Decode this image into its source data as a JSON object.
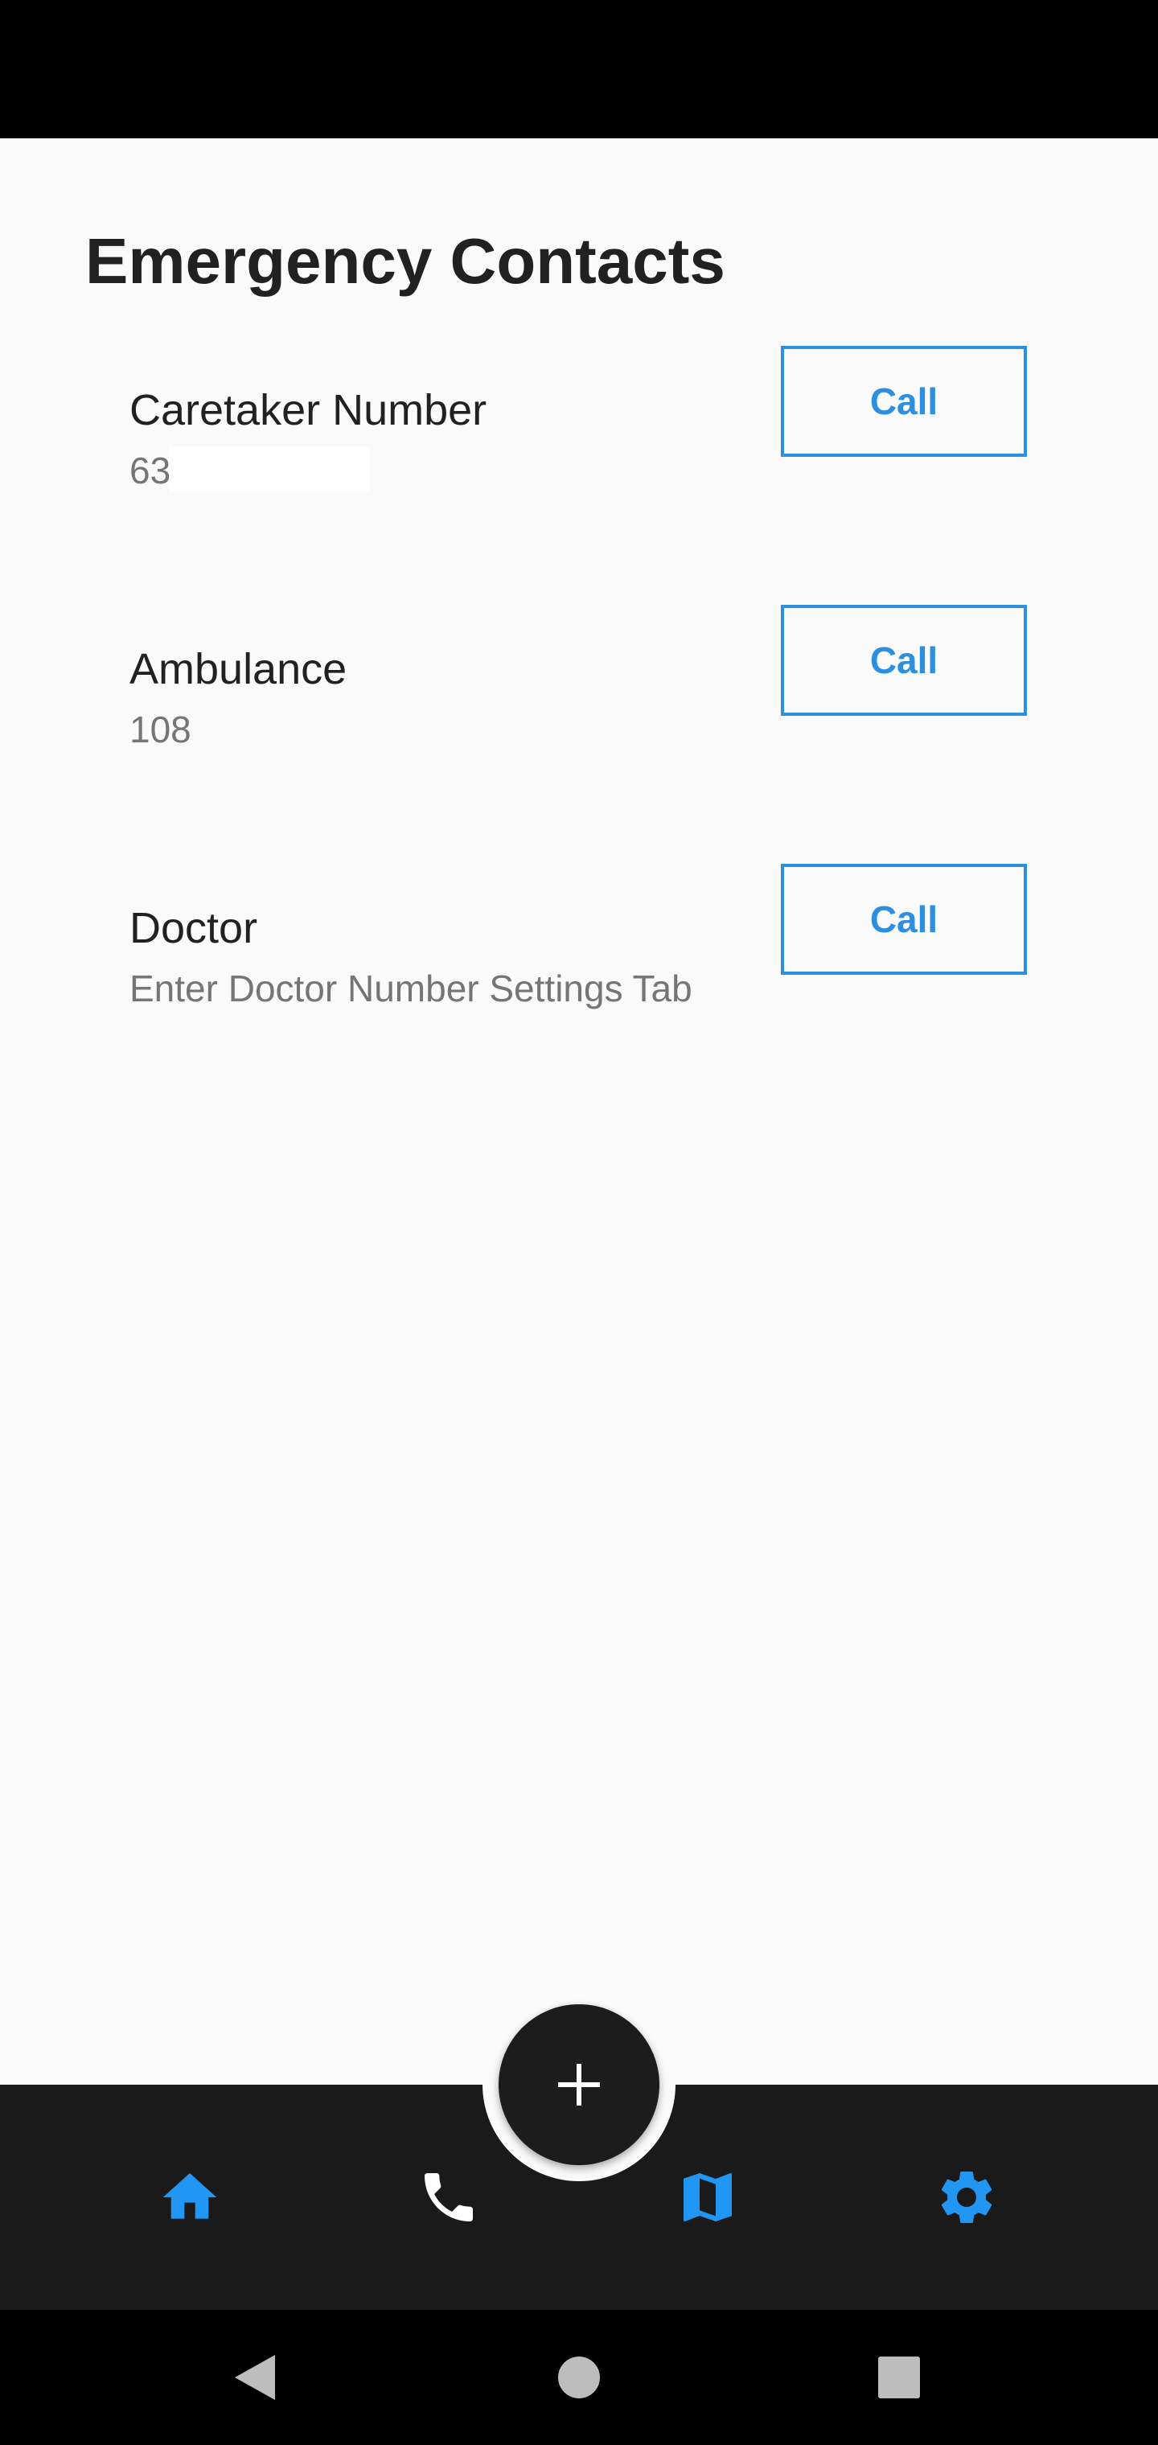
{
  "header": {
    "title": "Emergency Contacts"
  },
  "contacts": [
    {
      "name": "Caretaker Number",
      "number": "63",
      "call_label": "Call"
    },
    {
      "name": "Ambulance",
      "number": "108",
      "call_label": "Call"
    },
    {
      "name": "Doctor",
      "number": "Enter Doctor Number Settings Tab",
      "call_label": "Call"
    }
  ],
  "bottom_nav": {
    "items": [
      {
        "icon": "home-icon",
        "color": "#2196f3"
      },
      {
        "icon": "phone-icon",
        "color": "#ffffff"
      },
      {
        "icon": "map-icon",
        "color": "#2196f3"
      },
      {
        "icon": "settings-icon",
        "color": "#2196f3"
      }
    ],
    "fab_icon": "plus-icon"
  },
  "system_nav": [
    "back-icon",
    "home-circle-icon",
    "recents-icon"
  ],
  "colors": {
    "accent": "#2d8fe0",
    "bar": "#1a1a1a",
    "background": "#fafafa"
  }
}
